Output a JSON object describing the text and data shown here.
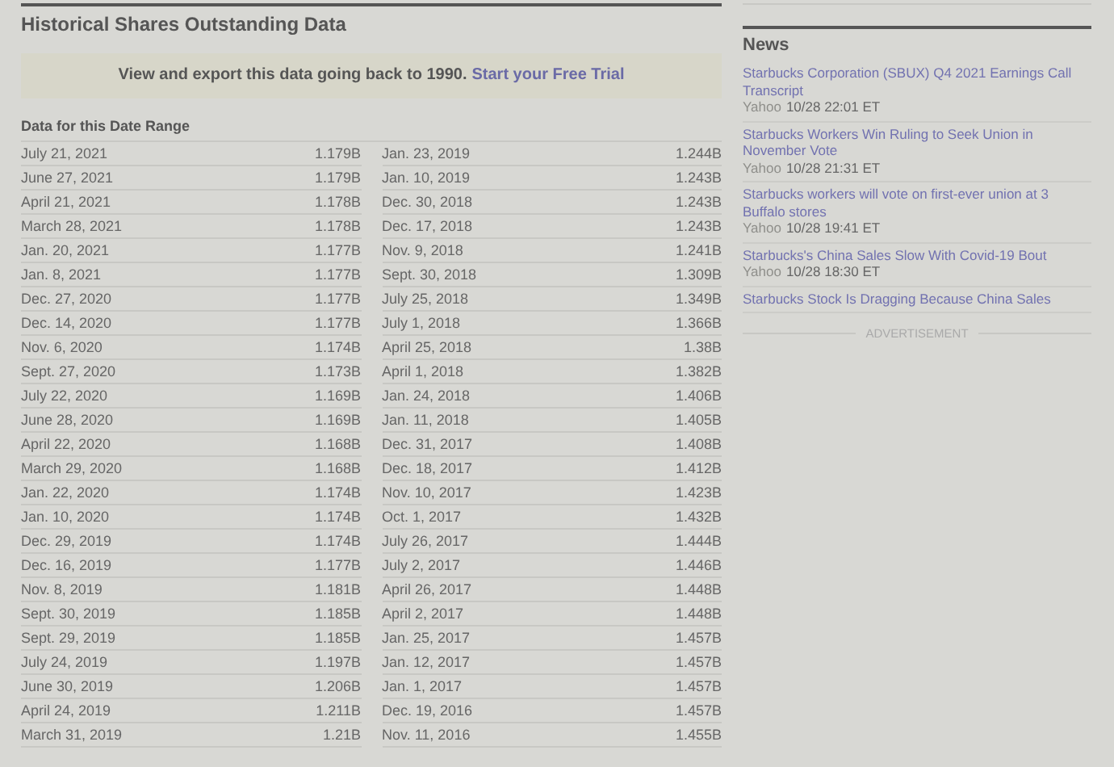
{
  "section": {
    "title": "Historical Shares Outstanding Data"
  },
  "banner": {
    "text": "View and export this data going back to 1990.",
    "link": "Start your Free Trial"
  },
  "table": {
    "caption": "Data for this Date Range",
    "left": [
      [
        "July 21, 2021",
        "1.179B"
      ],
      [
        "June 27, 2021",
        "1.179B"
      ],
      [
        "April 21, 2021",
        "1.178B"
      ],
      [
        "March 28, 2021",
        "1.178B"
      ],
      [
        "Jan. 20, 2021",
        "1.177B"
      ],
      [
        "Jan. 8, 2021",
        "1.177B"
      ],
      [
        "Dec. 27, 2020",
        "1.177B"
      ],
      [
        "Dec. 14, 2020",
        "1.177B"
      ],
      [
        "Nov. 6, 2020",
        "1.174B"
      ],
      [
        "Sept. 27, 2020",
        "1.173B"
      ],
      [
        "July 22, 2020",
        "1.169B"
      ],
      [
        "June 28, 2020",
        "1.169B"
      ],
      [
        "April 22, 2020",
        "1.168B"
      ],
      [
        "March 29, 2020",
        "1.168B"
      ],
      [
        "Jan. 22, 2020",
        "1.174B"
      ],
      [
        "Jan. 10, 2020",
        "1.174B"
      ],
      [
        "Dec. 29, 2019",
        "1.174B"
      ],
      [
        "Dec. 16, 2019",
        "1.177B"
      ],
      [
        "Nov. 8, 2019",
        "1.181B"
      ],
      [
        "Sept. 30, 2019",
        "1.185B"
      ],
      [
        "Sept. 29, 2019",
        "1.185B"
      ],
      [
        "July 24, 2019",
        "1.197B"
      ],
      [
        "June 30, 2019",
        "1.206B"
      ],
      [
        "April 24, 2019",
        "1.211B"
      ],
      [
        "March 31, 2019",
        "1.21B"
      ]
    ],
    "right": [
      [
        "Jan. 23, 2019",
        "1.244B"
      ],
      [
        "Jan. 10, 2019",
        "1.243B"
      ],
      [
        "Dec. 30, 2018",
        "1.243B"
      ],
      [
        "Dec. 17, 2018",
        "1.243B"
      ],
      [
        "Nov. 9, 2018",
        "1.241B"
      ],
      [
        "Sept. 30, 2018",
        "1.309B"
      ],
      [
        "July 25, 2018",
        "1.349B"
      ],
      [
        "July 1, 2018",
        "1.366B"
      ],
      [
        "April 25, 2018",
        "1.38B"
      ],
      [
        "April 1, 2018",
        "1.382B"
      ],
      [
        "Jan. 24, 2018",
        "1.406B"
      ],
      [
        "Jan. 11, 2018",
        "1.405B"
      ],
      [
        "Dec. 31, 2017",
        "1.408B"
      ],
      [
        "Dec. 18, 2017",
        "1.412B"
      ],
      [
        "Nov. 10, 2017",
        "1.423B"
      ],
      [
        "Oct. 1, 2017",
        "1.432B"
      ],
      [
        "July 26, 2017",
        "1.444B"
      ],
      [
        "July 2, 2017",
        "1.446B"
      ],
      [
        "April 26, 2017",
        "1.448B"
      ],
      [
        "April 2, 2017",
        "1.448B"
      ],
      [
        "Jan. 25, 2017",
        "1.457B"
      ],
      [
        "Jan. 12, 2017",
        "1.457B"
      ],
      [
        "Jan. 1, 2017",
        "1.457B"
      ],
      [
        "Dec. 19, 2016",
        "1.457B"
      ],
      [
        "Nov. 11, 2016",
        "1.455B"
      ]
    ]
  },
  "news": {
    "title": "News",
    "items": [
      {
        "headline": "Starbucks Corporation (SBUX) Q4 2021 Earnings Call Transcript",
        "source": "Yahoo",
        "time": "10/28 22:01 ET"
      },
      {
        "headline": "Starbucks Workers Win Ruling to Seek Union in November Vote",
        "source": "Yahoo",
        "time": "10/28 21:31 ET"
      },
      {
        "headline": "Starbucks workers will vote on first-ever union at 3 Buffalo stores",
        "source": "Yahoo",
        "time": "10/28 19:41 ET"
      },
      {
        "headline": "Starbucks's China Sales Slow With Covid-19 Bout",
        "source": "Yahoo",
        "time": "10/28 18:30 ET"
      },
      {
        "headline": "Starbucks Stock Is Dragging Because China Sales"
      }
    ],
    "advertisement": "ADVERTISEMENT"
  }
}
